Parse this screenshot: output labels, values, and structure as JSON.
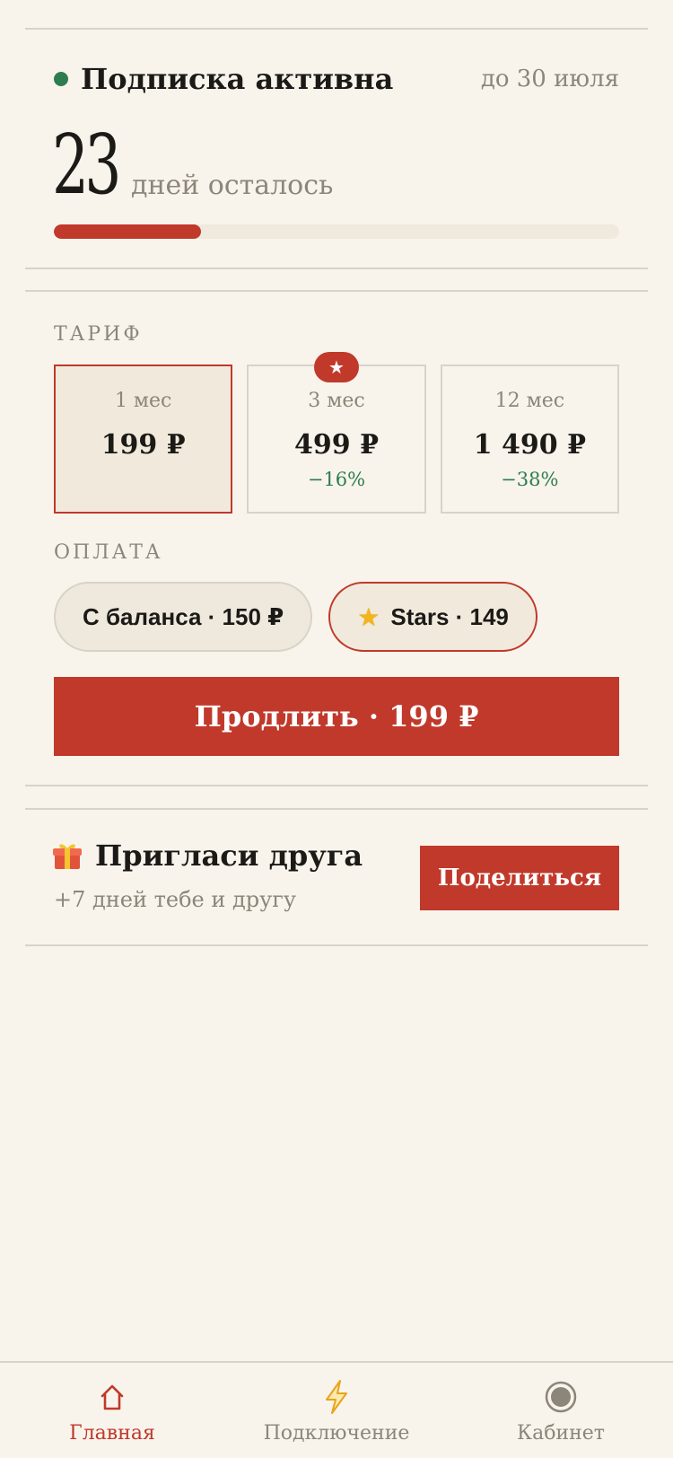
{
  "status": {
    "title": "Подписка активна",
    "until": "до 30 июля",
    "days_left": "23",
    "days_label": "дней осталось",
    "progress_fraction": 0.26,
    "status_color": "#2e7d4f"
  },
  "tariff": {
    "label": "ТАРИФ",
    "plans": [
      {
        "period": "1 мес",
        "price": "199 ₽",
        "discount": "",
        "selected": true,
        "badge": ""
      },
      {
        "period": "3 мес",
        "price": "499 ₽",
        "discount": "−16%",
        "selected": false,
        "badge": "★"
      },
      {
        "period": "12 мес",
        "price": "1 490 ₽",
        "discount": "−38%",
        "selected": false,
        "badge": ""
      }
    ]
  },
  "payment": {
    "label": "ОПЛАТА",
    "balance_label": "С баланса · 150 ₽",
    "stars_label": "Stars · 149",
    "stars_icon": "star-icon"
  },
  "cta": {
    "label": "Продлить · 199 ₽"
  },
  "referral": {
    "icon": "gift-icon",
    "title": "Пригласи друга",
    "subtitle": "+7 дней тебе и другу",
    "share_label": "Поделиться"
  },
  "nav": {
    "home": {
      "label": "Главная",
      "icon": "home-icon",
      "active": true
    },
    "connect": {
      "label": "Подключение",
      "icon": "lightning-icon",
      "active": false
    },
    "cabinet": {
      "label": "Кабинет",
      "icon": "profile-icon",
      "active": false
    }
  },
  "colors": {
    "accent": "#c0392b",
    "background": "#f8f4ec",
    "muted_text": "#8c8579",
    "success": "#2e7d4f"
  }
}
